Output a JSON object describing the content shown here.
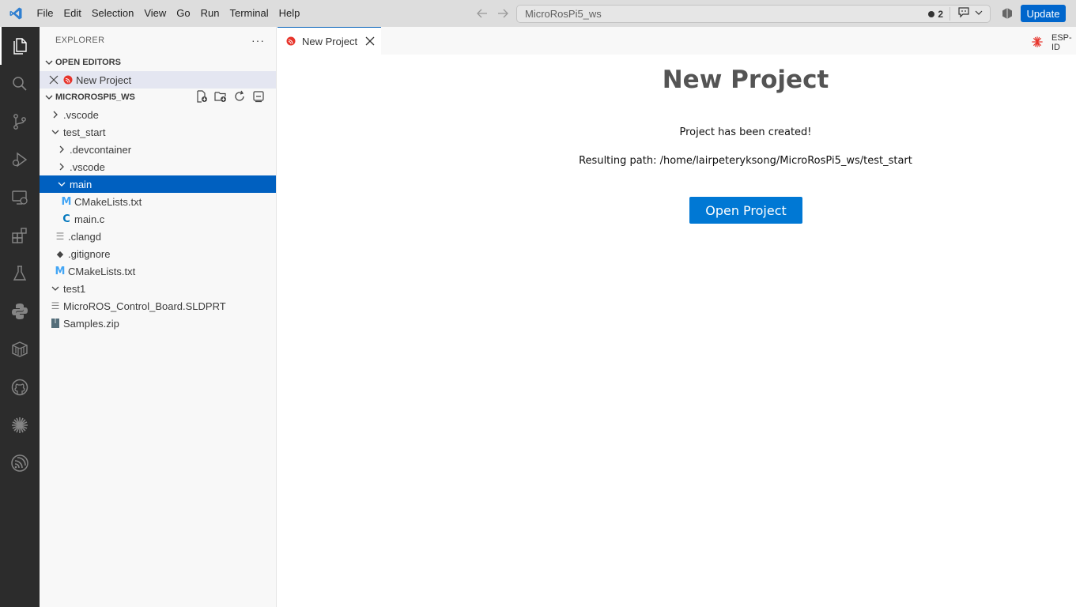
{
  "menu": [
    "File",
    "Edit",
    "Selection",
    "View",
    "Go",
    "Run",
    "Terminal",
    "Help"
  ],
  "command_center": {
    "title": "MicroRosPi5_ws",
    "notification_count": "2"
  },
  "update_label": "Update",
  "explorer": {
    "header": "EXPLORER",
    "more": "···",
    "open_editors_label": "OPEN EDITORS",
    "open_editors": [
      {
        "label": "New Project"
      }
    ],
    "workspace_label": "MICROROSPI5_WS",
    "tree": [
      {
        "label": ".vscode"
      },
      {
        "label": "test_start"
      },
      {
        "label": ".devcontainer"
      },
      {
        "label": ".vscode"
      },
      {
        "label": "main"
      },
      {
        "label": "CMakeLists.txt"
      },
      {
        "label": "main.c"
      },
      {
        "label": ".clangd"
      },
      {
        "label": ".gitignore"
      },
      {
        "label": "CMakeLists.txt"
      },
      {
        "label": "test1"
      },
      {
        "label": "MicroROS_Control_Board.SLDPRT"
      },
      {
        "label": "Samples.zip"
      }
    ]
  },
  "tabs": [
    {
      "label": "New Project"
    }
  ],
  "tab_right_label": "ESP-ID",
  "content": {
    "title": "New Project",
    "message": "Project has been created!",
    "path_label": "Resulting path: /home/lairpeteryksong/MicroRosPi5_ws/test_start",
    "button_label": "Open Project"
  },
  "colors": {
    "accent": "#0078d4",
    "selection": "#0060c0",
    "activity_bar": "#2c2c2c"
  }
}
